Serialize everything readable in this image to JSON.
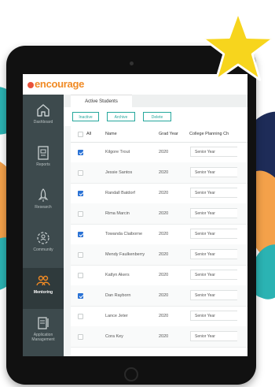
{
  "app": {
    "logo_text": "encourage",
    "logo_subtext": ""
  },
  "sidebar": {
    "items": [
      {
        "label": "Dashboard",
        "icon": "home-icon"
      },
      {
        "label": "Reports",
        "icon": "report-icon"
      },
      {
        "label": "Research",
        "icon": "rocket-icon"
      },
      {
        "label": "Community",
        "icon": "community-icon"
      },
      {
        "label": "Mentoring",
        "icon": "mentoring-icon",
        "active": true
      },
      {
        "label": "Application Management",
        "icon": "clipboard-icon"
      }
    ]
  },
  "tabs": {
    "active_label": "Active Students"
  },
  "actions": {
    "inactive_label": "Inactive",
    "archive_label": "Archive",
    "delete_label": "Delete"
  },
  "table": {
    "headers": {
      "select_all": "All",
      "name": "Name",
      "grad_year": "Grad Year",
      "college_planning": "College Planning Ch"
    },
    "rows": [
      {
        "checked": true,
        "name": "Kilgore Trout",
        "grad_year": "2020",
        "stage": "Senior Year"
      },
      {
        "checked": false,
        "name": "Jessie Santos",
        "grad_year": "2020",
        "stage": "Senior Year"
      },
      {
        "checked": true,
        "name": "Randall Batdorf",
        "grad_year": "2020",
        "stage": "Senior Year"
      },
      {
        "checked": false,
        "name": "Rima Marcin",
        "grad_year": "2020",
        "stage": "Senior Year"
      },
      {
        "checked": true,
        "name": "Towanda Claiborne",
        "grad_year": "2020",
        "stage": "Senior Year"
      },
      {
        "checked": false,
        "name": "Mendy Faulkenberry",
        "grad_year": "2020",
        "stage": "Senior Year"
      },
      {
        "checked": false,
        "name": "Katlyn Akers",
        "grad_year": "2020",
        "stage": "Senior Year"
      },
      {
        "checked": true,
        "name": "Dan Rayborn",
        "grad_year": "2020",
        "stage": "Senior Year"
      },
      {
        "checked": false,
        "name": "Lance Jeter",
        "grad_year": "2020",
        "stage": "Senior Year"
      },
      {
        "checked": false,
        "name": "Cora Key",
        "grad_year": "2020",
        "stage": "Senior Year"
      }
    ]
  },
  "colors": {
    "accent": "#25a79c",
    "checkbox": "#2a72d5",
    "sidebar": "#3d4a4d",
    "star": "#f7d51d",
    "logo": "#f08a24"
  }
}
